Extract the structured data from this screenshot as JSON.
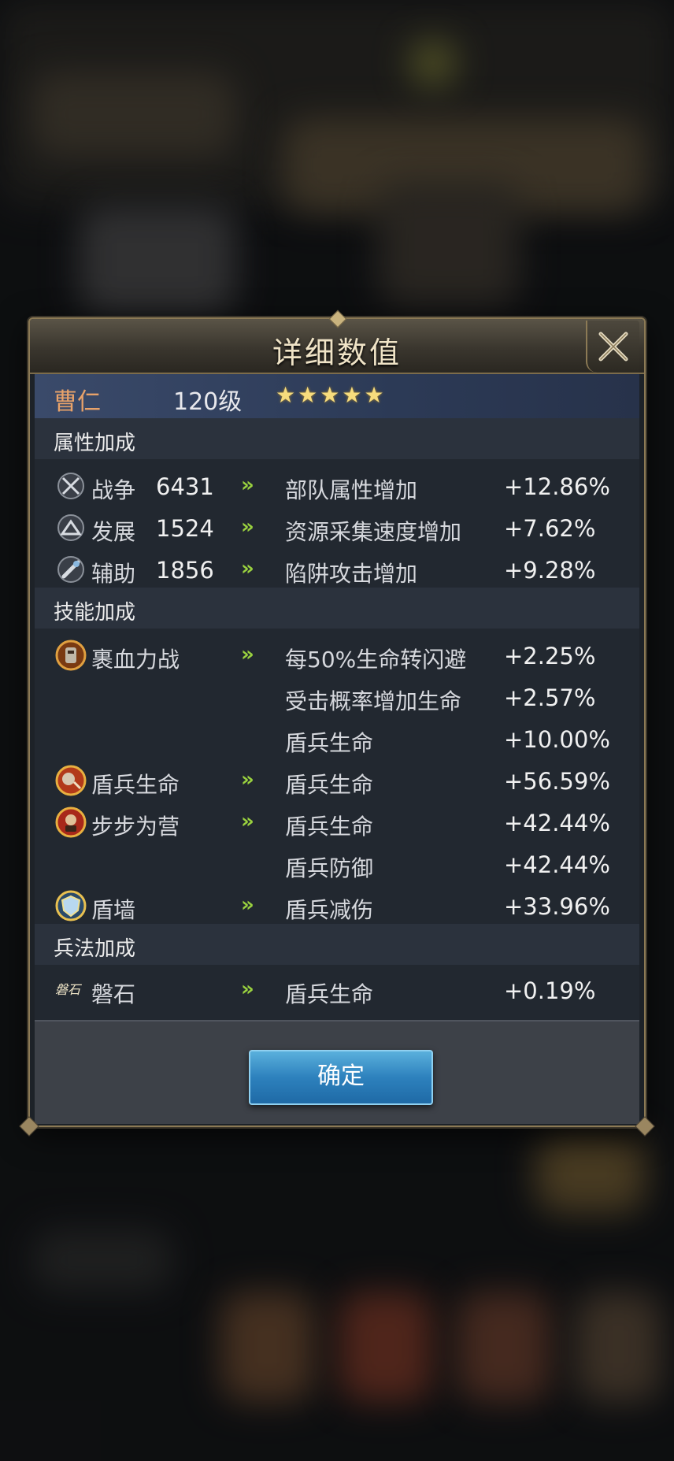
{
  "dialog": {
    "title": "详细数值",
    "hero": {
      "name": "曹仁",
      "level": "120级",
      "stars": [
        "★",
        "★",
        "★",
        "★",
        "★"
      ]
    },
    "sections": {
      "attributes": "属性加成",
      "skills": "技能加成",
      "tactics": "兵法加成"
    },
    "attribute_rows": [
      {
        "icon": "crossed-swords-icon",
        "name": "战争",
        "num": "6431",
        "arrow": "»",
        "effect": "部队属性增加",
        "value": "+12.86%"
      },
      {
        "icon": "development-icon",
        "name": "发展",
        "num": "1524",
        "arrow": "»",
        "effect": "资源采集速度增加",
        "value": "+7.62%"
      },
      {
        "icon": "support-icon",
        "name": "辅助",
        "num": "1856",
        "arrow": "»",
        "effect": "陷阱攻击增加",
        "value": "+9.28%"
      }
    ],
    "skill_rows": [
      {
        "icon": "armor-skill-icon",
        "name": "裹血力战",
        "arrow": "»",
        "effect": "每50%生命转闪避",
        "value": "+2.25%"
      },
      {
        "effect": "受击概率增加生命",
        "value": "+2.57%"
      },
      {
        "effect": "盾兵生命",
        "value": "+10.00%"
      },
      {
        "icon": "shield-hp-skill-icon",
        "name": "盾兵生命",
        "arrow": "»",
        "effect": "盾兵生命",
        "value": "+56.59%"
      },
      {
        "icon": "camp-skill-icon",
        "name": "步步为营",
        "arrow": "»",
        "effect": "盾兵生命",
        "value": "+42.44%"
      },
      {
        "effect": "盾兵防御",
        "value": "+42.44%"
      },
      {
        "icon": "shield-wall-skill-icon",
        "name": "盾墙",
        "arrow": "»",
        "effect": "盾兵减伤",
        "value": "+33.96%"
      }
    ],
    "tactic_rows": [
      {
        "icon": "boulder-tactic-icon",
        "icon_text": "磐石",
        "name": "磐石",
        "arrow": "»",
        "effect": "盾兵生命",
        "value": "+0.19%"
      }
    ],
    "confirm_label": "确定"
  },
  "colors": {
    "hero_name": "#e8a26a",
    "arrow": "#9ad23f",
    "star": "#f7dc7d",
    "confirm_button": "#2d81bd"
  }
}
